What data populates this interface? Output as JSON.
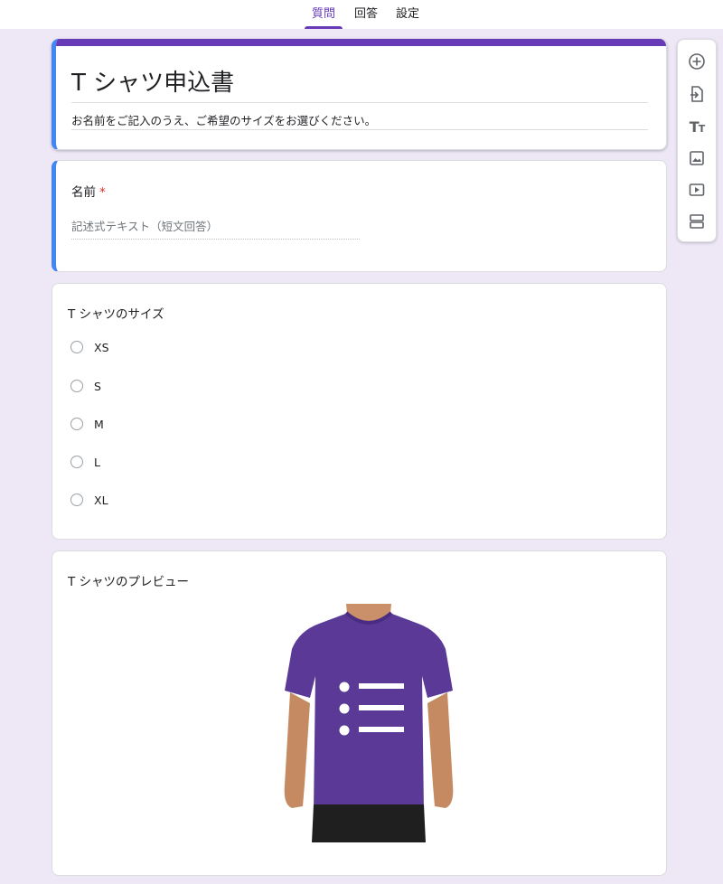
{
  "tabs": [
    {
      "label": "質問",
      "active": true
    },
    {
      "label": "回答",
      "active": false
    },
    {
      "label": "設定",
      "active": false
    }
  ],
  "form": {
    "title": "T シャツ申込書",
    "description": "お名前をご記入のうえ、ご希望のサイズをお選びください。"
  },
  "name_question": {
    "title": "名前",
    "required_mark": "*",
    "placeholder": "記述式テキスト（短文回答）"
  },
  "size_question": {
    "title": "T シャツのサイズ",
    "options": [
      "XS",
      "S",
      "M",
      "L",
      "XL"
    ]
  },
  "preview": {
    "title": "T シャツのプレビュー"
  },
  "toolbar": {
    "icons": [
      "add-question-icon",
      "import-questions-icon",
      "add-title-icon",
      "add-image-icon",
      "add-video-icon",
      "add-section-icon"
    ]
  },
  "colors": {
    "accent": "#673ab7",
    "focus": "#4285f4",
    "background": "#ede7f6",
    "required": "#d93025",
    "shirt": "#5a3a96"
  }
}
